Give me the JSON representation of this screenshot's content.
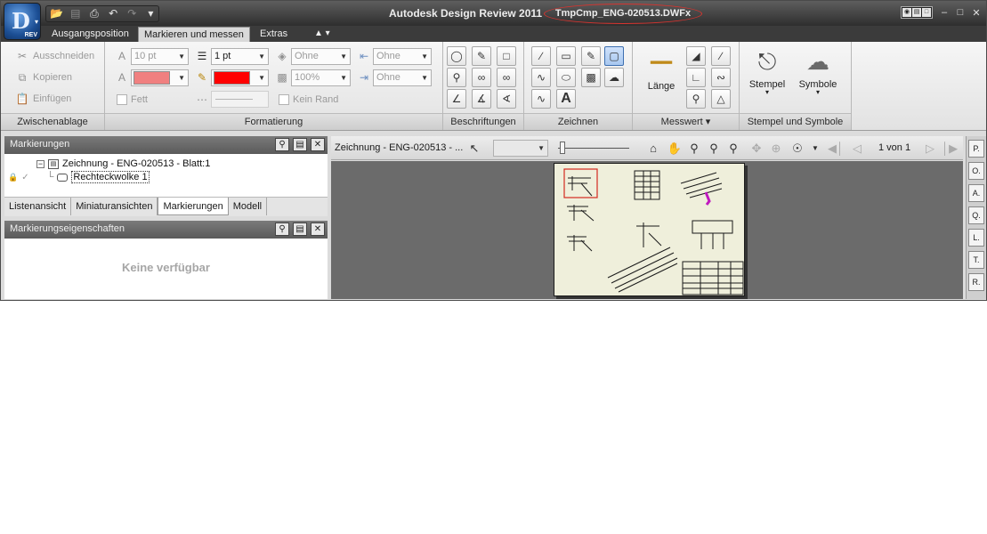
{
  "window": {
    "app_title": "Autodesk Design Review 2011",
    "file_name": "TmpCmp_ENG-020513.DWFx",
    "app_button_badge": "REV"
  },
  "ribbon_tabs": [
    {
      "label": "Ausgangsposition",
      "active": false
    },
    {
      "label": "Markieren und messen",
      "active": true
    },
    {
      "label": "Extras",
      "active": false
    }
  ],
  "clipboard": {
    "title": "Zwischenablage",
    "cut": "Ausschneiden",
    "copy": "Kopieren",
    "paste": "Einfügen"
  },
  "formatting": {
    "title": "Formatierung",
    "font_size": "10 pt",
    "line_weight": "1 pt",
    "fill_none": "Ohne",
    "opacity": "100%",
    "arrow_start": "Ohne",
    "arrow_end": "Ohne",
    "bold": "Fett",
    "no_border": "Kein Rand",
    "text_color": "#f08080",
    "line_color": "#ff0000"
  },
  "panels": {
    "annotations": "Beschriftungen",
    "draw": "Zeichnen",
    "measure": "Messwert",
    "measure_length": "Länge",
    "stamps_symbols": "Stempel und Symbole",
    "stamp": "Stempel",
    "symbols": "Symbole"
  },
  "markups_panel": {
    "title": "Markierungen",
    "tree_root": "Zeichnung - ENG-020513 - Blatt:1",
    "tree_child": "Rechteckwolke 1"
  },
  "panel_tabs": [
    {
      "label": "Listenansicht",
      "active": false
    },
    {
      "label": "Miniaturansichten",
      "active": false
    },
    {
      "label": "Markierungen",
      "active": true
    },
    {
      "label": "Modell",
      "active": false
    }
  ],
  "properties_panel": {
    "title": "Markierungseigenschaften",
    "empty_text": "Keine verfügbar"
  },
  "canvas": {
    "doc_label": "Zeichnung - ENG-020513 - ...",
    "page_status": "1 von 1"
  },
  "right_tabs": [
    "P.",
    "O.",
    "A.",
    "Q.",
    "L.",
    "T.",
    "R."
  ]
}
